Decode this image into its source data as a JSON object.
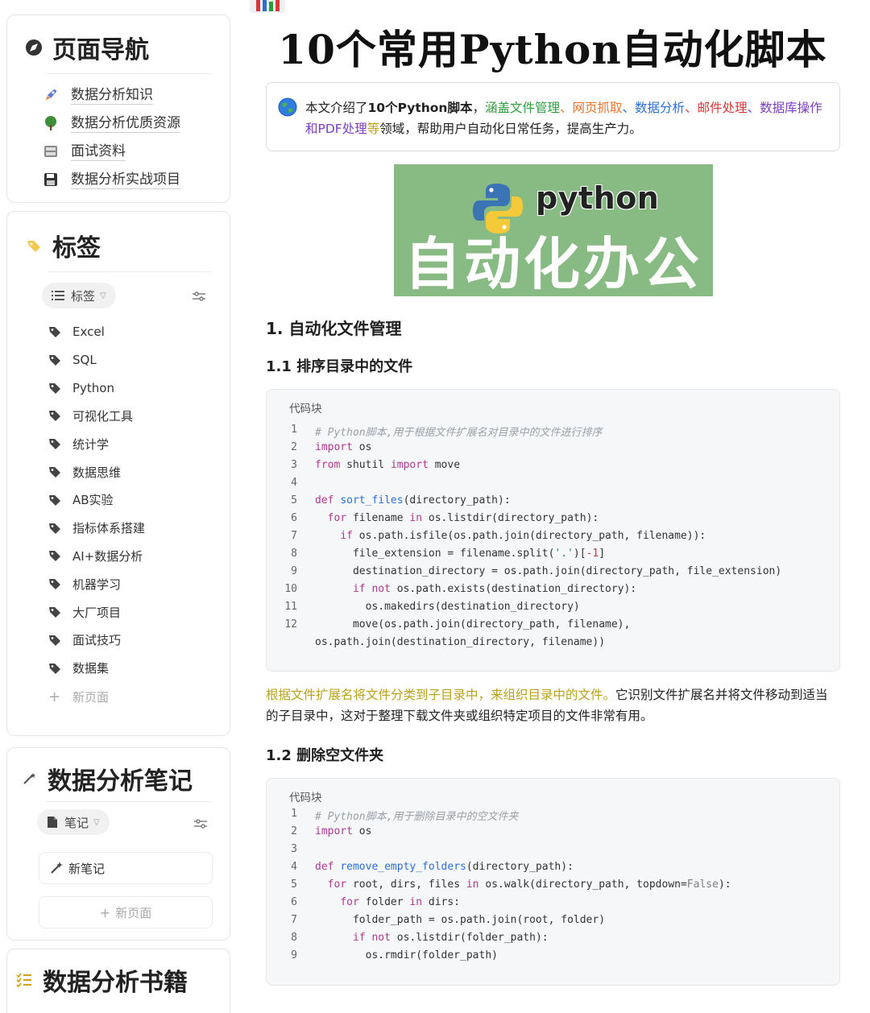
{
  "sidebar": {
    "nav": {
      "title": "页面导航",
      "items": [
        {
          "label": "数据分析知识",
          "icon": "rocket-icon"
        },
        {
          "label": "数据分析优质资源",
          "icon": "tree-icon"
        },
        {
          "label": "面试资料",
          "icon": "cabinet-icon"
        },
        {
          "label": "数据分析实战项目",
          "icon": "floppy-icon"
        }
      ]
    },
    "tags": {
      "title": "标签",
      "view_pill": "标签",
      "items": [
        "Excel",
        "SQL",
        "Python",
        "可视化工具",
        "统计学",
        "数据思维",
        "AB实验",
        "指标体系搭建",
        "AI+数据分析",
        "机器学习",
        "大厂项目",
        "面试技巧",
        "数据集"
      ],
      "new_page": "新页面"
    },
    "notes": {
      "title": "数据分析笔记",
      "view_pill": "笔记",
      "new_note": "新笔记",
      "new_page": "新页面"
    },
    "books": {
      "title": "数据分析书籍"
    }
  },
  "main": {
    "title": "10个常用Python自动化脚本",
    "callout": {
      "p1": "本文介绍了",
      "p2": "10个Python脚本",
      "p3": "，",
      "p4": "涵盖文件管理",
      "p5": "、",
      "p6": "网页抓取",
      "p7": "、",
      "p8": "数据分析",
      "p9": "、",
      "p10": "邮件处理",
      "p11": "、",
      "p12": "数据库操作和PDF处理",
      "p13": "等",
      "p14": "领域，帮助用户自动化日常任务，提高生产力。"
    },
    "banner": {
      "logo_text": "python",
      "big_text": "自动化办公"
    },
    "section1": "1. 自动化文件管理",
    "section1_1": "1.1 排序目录中的文件",
    "code1": {
      "lang": "代码块",
      "lines": [
        "1",
        "2",
        "3",
        "4",
        "5",
        "6",
        "7",
        "8",
        "9",
        "10",
        "11",
        "12"
      ]
    },
    "para1": {
      "highlight": "根据文件扩展名将文件分类到子目录中，来组织目录中的文件。",
      "rest": "它识别文件扩展名并将文件移动到适当的子目录中，这对于整理下载文件夹或组织特定项目的文件非常有用。"
    },
    "section1_2": "1.2 删除空文件夹",
    "code2": {
      "lang": "代码块"
    }
  },
  "colors": {
    "accent_green": "#2e9c3c",
    "accent_orange": "#e8732a",
    "accent_blue": "#2a6fd6",
    "accent_red": "#d93737",
    "accent_purple": "#7a3fc1",
    "accent_olive": "#b9a21a",
    "banner_bg": "#88ba84"
  }
}
